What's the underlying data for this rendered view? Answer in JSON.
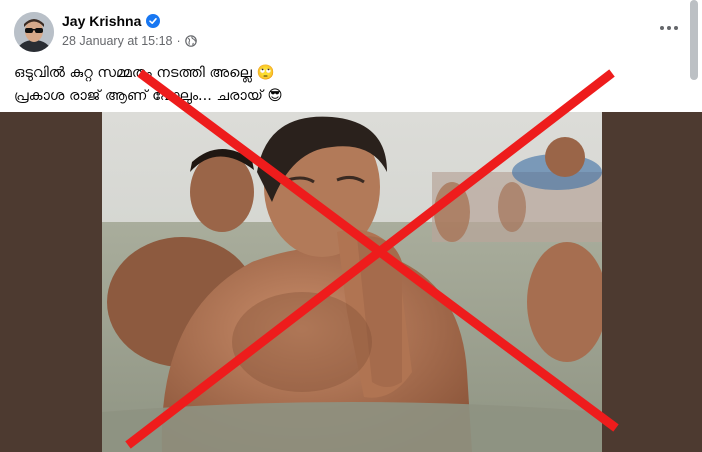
{
  "post": {
    "author_name": "Jay Krishna",
    "timestamp": "28 January at 15:18",
    "separator": "·",
    "audience_icon": "globe-icon",
    "verified_icon": "verified-badge-icon",
    "more_icon": "more-options-icon",
    "text_lines": [
      "ഒടുവിൽ കുറ്റ സമ്മതം നടത്തി അല്ലെ 🙄",
      "പ്രകാശ രാജ് ആണ് പോലും... ചരായ് 😎"
    ],
    "image_alt": "Man bathing in river with folded hands, crossed out with red X",
    "overlay": "red-x-cross"
  },
  "colors": {
    "accent": "#1877f2",
    "text": "#050505",
    "secondary_text": "#65676b",
    "image_frame": "#4d3a30",
    "cross": "#ee1c1c"
  }
}
